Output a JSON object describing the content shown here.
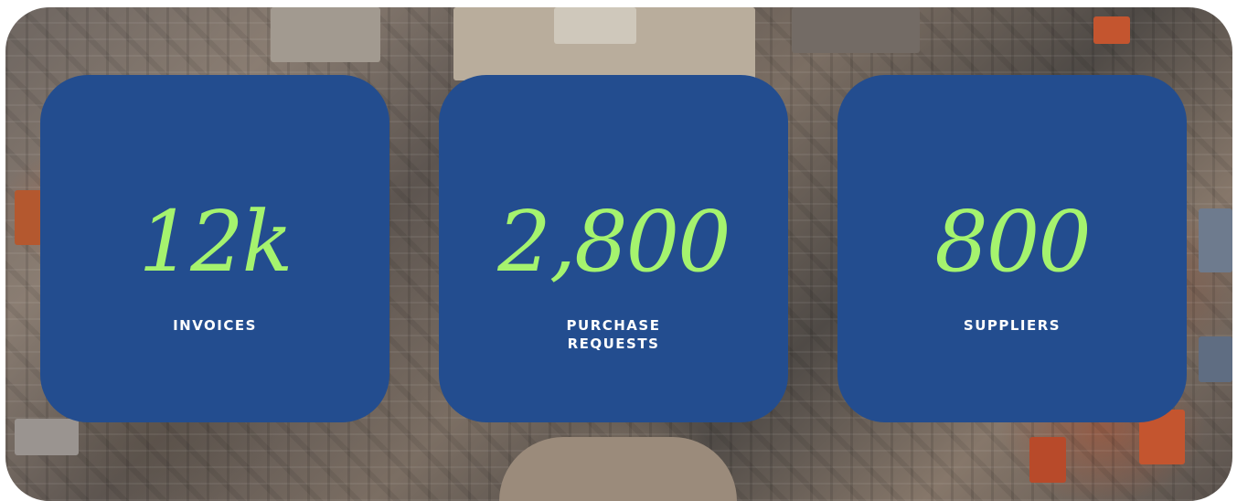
{
  "stats": [
    {
      "value": "12k",
      "label_lines": [
        "INVOICES"
      ]
    },
    {
      "value": "2,800",
      "label_lines": [
        "PURCHASE",
        "REQUESTS"
      ]
    },
    {
      "value": "800",
      "label_lines": [
        "SUPPLIERS"
      ]
    }
  ],
  "colors": {
    "card_background": "#234d8f",
    "value_text": "#a5f36e",
    "label_text": "#ffffff"
  },
  "background_image": "aerial-city-square-photo"
}
